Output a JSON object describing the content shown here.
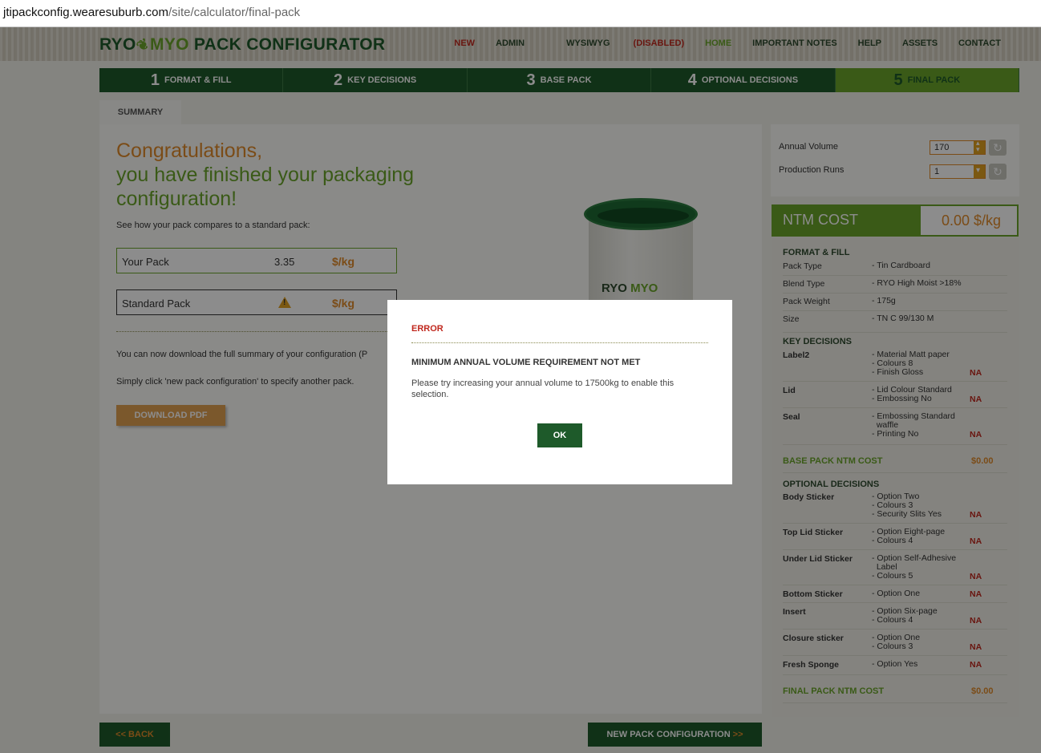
{
  "browser": {
    "url_host": "jtipackconfig.wearesuburb.com",
    "url_path": "/site/calculator/final-pack"
  },
  "header": {
    "logo_ryo": "RYO",
    "logo_myo": "MYO",
    "logo_rest": "PACK CONFIGURATOR",
    "nav": {
      "new": "NEW",
      "admin": "ADMIN",
      "wysiwyg": "WYSIWYG",
      "disabled": "(DISABLED)",
      "home": "HOME",
      "notes": "IMPORTANT NOTES",
      "help": "HELP",
      "assets": "ASSETS",
      "contact": "CONTACT"
    }
  },
  "steps": [
    {
      "num": "1",
      "label": "FORMAT & FILL"
    },
    {
      "num": "2",
      "label": "KEY DECISIONS"
    },
    {
      "num": "3",
      "label": "BASE PACK"
    },
    {
      "num": "4",
      "label": "OPTIONAL DECISIONS"
    },
    {
      "num": "5",
      "label": "FINAL PACK"
    }
  ],
  "tab": "SUMMARY",
  "main": {
    "congrats_line1": "Congratulations,",
    "congrats_line2": "you have finished your packaging",
    "congrats_line3": "configuration!",
    "compare_text": "See how your pack compares to a standard pack:",
    "your_pack_label": "Your Pack",
    "your_pack_value": "3.35",
    "unit": "$/kg",
    "standard_pack_label": "Standard Pack",
    "download_text": "You can now download the full summary of your configuration (P",
    "new_config_text": "Simply click 'new pack configuration' to specify another pack.",
    "download_button": "DOWNLOAD PDF",
    "tin_brand_ryo": "RYO",
    "tin_brand_myo": "MYO"
  },
  "footer": {
    "back": "<< BACK",
    "new_pack": "NEW PACK CONFIGURATION",
    "new_pack_arrow": ">>"
  },
  "volume": {
    "annual_label": "Annual Volume",
    "annual_value": "170",
    "runs_label": "Production Runs",
    "runs_value": "1"
  },
  "ntm": {
    "label": "NTM COST",
    "value": "0.00 $/kg"
  },
  "cost": {
    "format_head": "FORMAT & FILL",
    "pack_type_k": "Pack Type",
    "pack_type_v": "- Tin Cardboard",
    "blend_k": "Blend Type",
    "blend_v": "- RYO High Moist >18%",
    "weight_k": "Pack Weight",
    "weight_v": "- 175g",
    "size_k": "Size",
    "size_v": "- TN C 99/130 M",
    "key_head": "KEY DECISIONS",
    "label2_k": "Label2",
    "label2_v1": "- Material Matt paper",
    "label2_v2": "- Colours 8",
    "label2_v3": "- Finish Gloss",
    "lid_k": "Lid",
    "lid_v1": "- Lid Colour Standard",
    "lid_v2": "- Embossing No",
    "seal_k": "Seal",
    "seal_v1": "- Embossing Standard",
    "seal_v2": "waffle",
    "seal_v3": "- Printing No",
    "na": "NA",
    "base_total": "BASE PACK NTM COST",
    "base_amt": "$0.00",
    "opt_head": "OPTIONAL DECISIONS",
    "body_k": "Body Sticker",
    "body_v1": "- Option Two",
    "body_v2": "- Colours 3",
    "body_v3": "- Security Slits Yes",
    "top_k": "Top Lid Sticker",
    "top_v1": "- Option Eight-page",
    "top_v2": "- Colours 4",
    "under_k": "Under Lid Sticker",
    "under_v1": "- Option Self-Adhesive",
    "under_v2": "Label",
    "under_v3": "- Colours 5",
    "bottom_k": "Bottom Sticker",
    "bottom_v1": "- Option One",
    "insert_k": "Insert",
    "insert_v1": "- Option Six-page",
    "insert_v2": "- Colours 4",
    "closure_k": "Closure sticker",
    "closure_v1": "- Option One",
    "closure_v2": "- Colours 3",
    "sponge_k": "Fresh Sponge",
    "sponge_v1": "- Option Yes",
    "final_total": "FINAL PACK NTM COST",
    "final_amt": "$0.00"
  },
  "modal": {
    "title": "ERROR",
    "heading": "MINIMUM ANNUAL VOLUME REQUIREMENT NOT MET",
    "message": "Please try increasing your annual volume to 17500kg to enable this selection.",
    "ok": "OK"
  },
  "colors": {
    "dark_green": "#1e5a2a",
    "light_green": "#6aa52a",
    "orange": "#e08a2a",
    "red": "#c0281e"
  }
}
